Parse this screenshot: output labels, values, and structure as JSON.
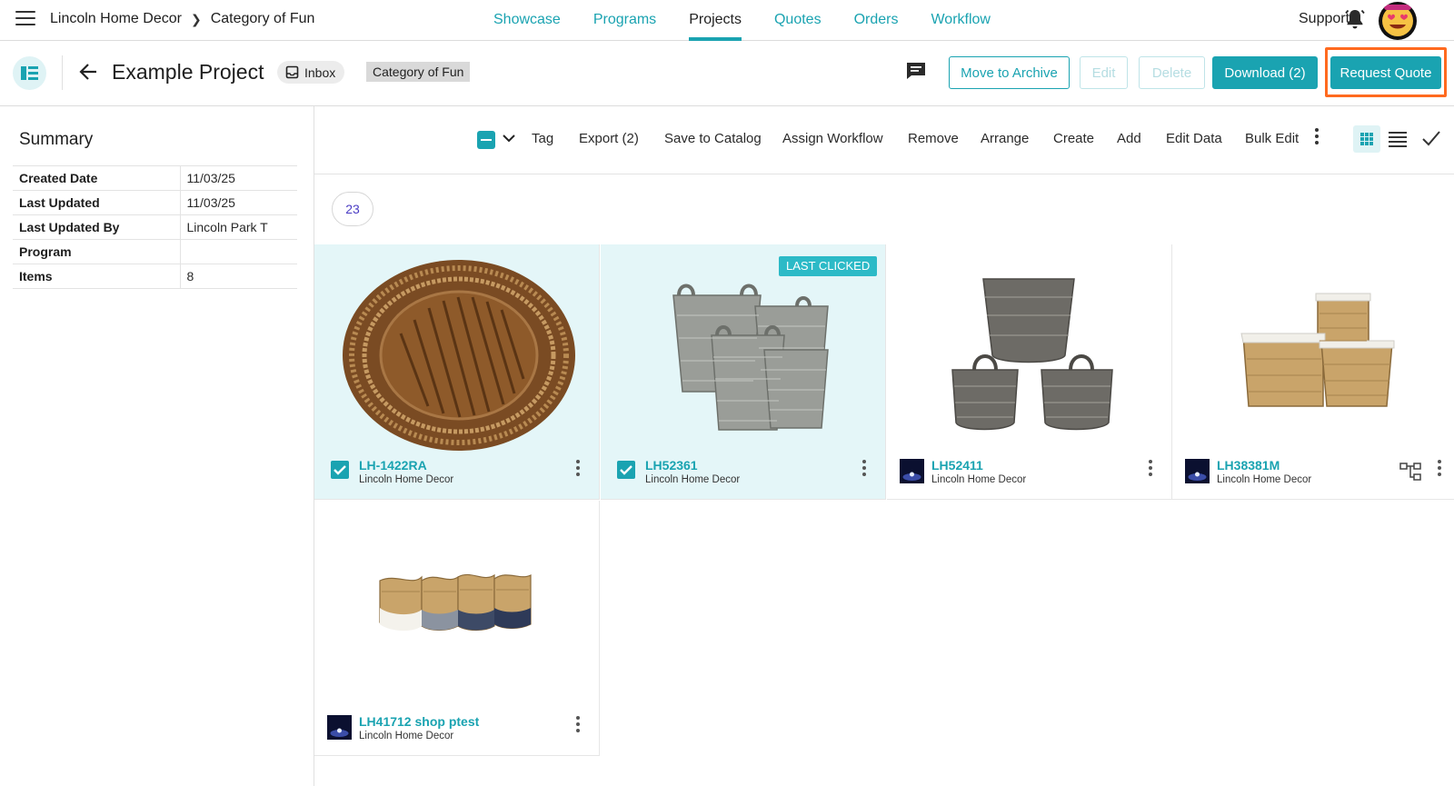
{
  "topnav": {
    "brand": "Lincoln Home Decor",
    "crumb": "Category of Fun",
    "links": [
      "Showcase",
      "Programs",
      "Projects",
      "Quotes",
      "Orders",
      "Workflow"
    ],
    "active": "Projects",
    "support": "Support"
  },
  "project": {
    "title": "Example Project",
    "inbox": "Inbox",
    "category": "Category of Fun",
    "buttons": {
      "archive": "Move to Archive",
      "edit": "Edit",
      "delete": "Delete",
      "download": "Download (2)",
      "request_quote": "Request Quote"
    }
  },
  "summary": {
    "title": "Summary",
    "rows": [
      {
        "label": "Created Date",
        "value": "11/03/25"
      },
      {
        "label": "Last Updated",
        "value": "11/03/25"
      },
      {
        "label": "Last Updated By",
        "value": "Lincoln Park T"
      },
      {
        "label": "Program",
        "value": ""
      },
      {
        "label": "Items",
        "value": "8"
      }
    ]
  },
  "toolbar": {
    "tag": "Tag",
    "export": "Export (2)",
    "save_catalog": "Save to Catalog",
    "assign_workflow": "Assign Workflow",
    "remove": "Remove",
    "arrange": "Arrange",
    "create": "Create",
    "add": "Add",
    "edit_data": "Edit Data",
    "bulk_edit": "Bulk Edit"
  },
  "count": "23",
  "items": [
    {
      "sku": "LH-1422RA",
      "vendor": "Lincoln Home Decor",
      "selected": true
    },
    {
      "sku": "LH52361",
      "vendor": "Lincoln Home Decor",
      "selected": true,
      "badge": "LAST CLICKED"
    },
    {
      "sku": "LH52411",
      "vendor": "Lincoln Home Decor",
      "selected": false
    },
    {
      "sku": "LH38381M",
      "vendor": "Lincoln Home Decor",
      "selected": false
    },
    {
      "sku": "LH41712 shop ptest",
      "vendor": "Lincoln Home Decor",
      "selected": false
    }
  ],
  "colors": {
    "accent": "#1aa3b1",
    "highlight": "#ff6a1f",
    "selected_bg": "#e4f6f8"
  }
}
